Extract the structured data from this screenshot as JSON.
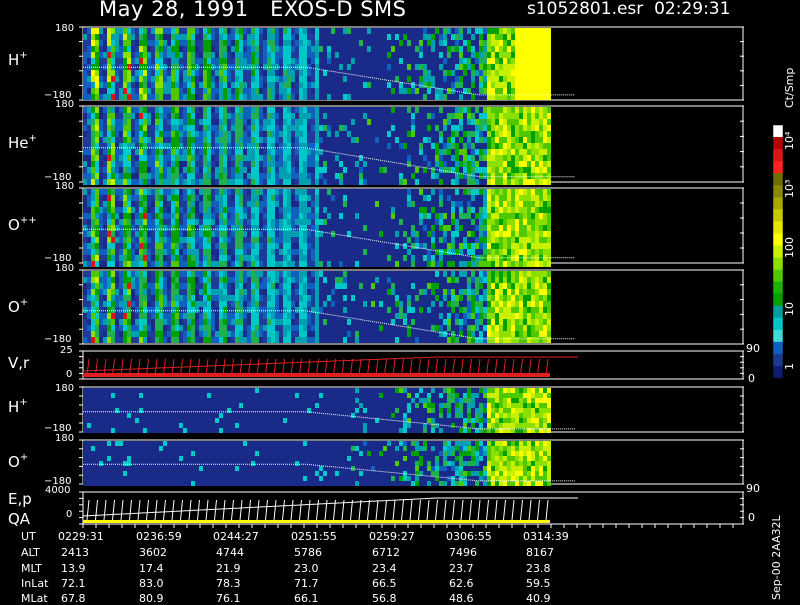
{
  "header": {
    "title": "May 28, 1991   EXOS-D SMS",
    "file": "s1052801.esr  02:29:31"
  },
  "colorbar": {
    "units": "Ct/Smp",
    "ticks": [
      "10⁴",
      "10³",
      "100",
      "10",
      "1"
    ],
    "colors": [
      "#ffffff",
      "#b00000",
      "#d81818",
      "#ff2020",
      "#6e6e00",
      "#8a8a00",
      "#a8a800",
      "#c8c800",
      "#e6e600",
      "#ffff00",
      "#c8f000",
      "#8ce000",
      "#50c800",
      "#20b000",
      "#00a000",
      "#00a0a0",
      "#00c8c8",
      "#40d8d8",
      "#1060c0",
      "#1a3a90",
      "#101c70"
    ]
  },
  "panels": [
    {
      "label": "H",
      "sup": "+",
      "ymax": "180",
      "ymin": "−180"
    },
    {
      "label": "He",
      "sup": "+",
      "ymax": "180",
      "ymin": "−180"
    },
    {
      "label": "O",
      "sup": "++",
      "ymax": "180",
      "ymin": "−180"
    },
    {
      "label": "O",
      "sup": "+",
      "ymax": "180",
      "ymin": "−180"
    },
    {
      "label": "V,r",
      "sup": "",
      "ymax": "25",
      "ymin": "0",
      "rmax": "90",
      "rmin": "0"
    },
    {
      "label": "H",
      "sup": "+",
      "ymax": "180",
      "ymin": "−180"
    },
    {
      "label": "O",
      "sup": "+",
      "ymax": "180",
      "ymin": "−180"
    },
    {
      "label": "E,p",
      "label2": "QA",
      "sup": "",
      "ymax": "4000",
      "ymin": "0",
      "rmax": "90",
      "rmin": "0"
    }
  ],
  "chart_data": {
    "type": "heatmap",
    "title": "May 28, 1991   EXOS-D SMS",
    "x_axis": "UT",
    "x_ticks": [
      "0229:31",
      "0236:59",
      "0244:27",
      "0251:55",
      "0259:27",
      "0306:55",
      "0314:39"
    ],
    "ephemeris": [
      {
        "name": "UT",
        "values": [
          "0229:31",
          "0236:59",
          "0244:27",
          "0251:55",
          "0259:27",
          "0306:55",
          "0314:39"
        ]
      },
      {
        "name": "ALT",
        "values": [
          "2413",
          "3602",
          "4744",
          "5786",
          "6712",
          "7496",
          "8167"
        ]
      },
      {
        "name": "MLT",
        "values": [
          "13.9",
          "17.4",
          "21.9",
          "23.0",
          "23.4",
          "23.7",
          "23.8"
        ]
      },
      {
        "name": "InLat",
        "values": [
          "72.1",
          "83.0",
          "78.3",
          "71.7",
          "66.5",
          "62.6",
          "59.5"
        ]
      },
      {
        "name": "MLat",
        "values": [
          "67.8",
          "80.9",
          "76.1",
          "66.1",
          "56.8",
          "48.6",
          "40.9"
        ]
      }
    ],
    "y_range_pitch": [
      -180,
      180
    ],
    "colorbar_range": [
      1,
      10000
    ],
    "log_color_scale": true
  },
  "footer": "Sep-00  2AA32L"
}
